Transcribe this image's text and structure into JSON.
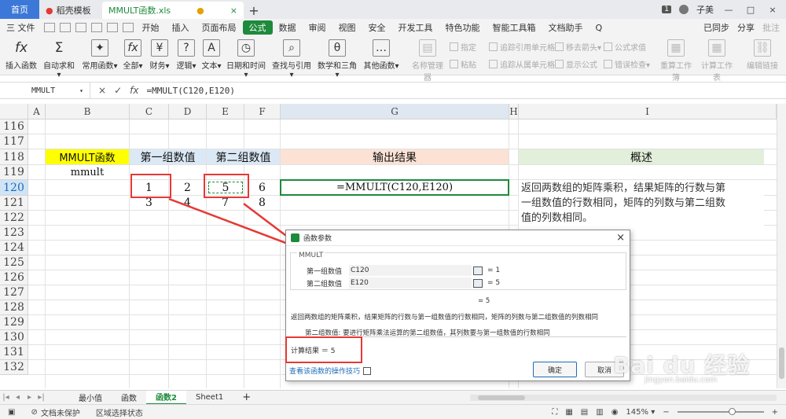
{
  "titlebar": {
    "home": "首页",
    "tab1": "稻壳模板",
    "tab2": "MMULT函数.xls",
    "tab2_dot": "●",
    "tab2_close": "×",
    "plus": "+",
    "badge": "1",
    "user": "子美",
    "min": "—",
    "max": "□",
    "close": "×"
  },
  "menubar": {
    "file": "三 文件",
    "items": [
      "开始",
      "插入",
      "页面布局",
      "公式",
      "数据",
      "审阅",
      "视图",
      "安全",
      "开发工具",
      "特色功能",
      "智能工具箱",
      "文档助手"
    ],
    "search": "Q",
    "sync": "已同步",
    "share": "分享",
    "comment": "批注"
  },
  "ribbon": {
    "buttons": [
      {
        "label": "插入函数",
        "icon": "fx"
      },
      {
        "label": "自动求和▾",
        "icon": "Σ"
      },
      {
        "label": "常用函数▾",
        "icon": "✦"
      },
      {
        "label": "全部▾",
        "icon": "fx"
      },
      {
        "label": "财务▾",
        "icon": "¥"
      },
      {
        "label": "逻辑▾",
        "icon": "?"
      },
      {
        "label": "文本▾",
        "icon": "A"
      },
      {
        "label": "日期和时间▾",
        "icon": "◷"
      },
      {
        "label": "查找与引用▾",
        "icon": "⌕"
      },
      {
        "label": "数学和三角▾",
        "icon": "θ"
      },
      {
        "label": "其他函数▾",
        "icon": "…"
      }
    ],
    "dim_buttons": [
      {
        "label": "名称管理器",
        "icon": "▤"
      },
      {
        "label": "重算工作簿",
        "icon": "▦"
      },
      {
        "label": "计算工作表",
        "icon": "▦"
      },
      {
        "label": "编辑链接",
        "icon": "⛓"
      }
    ],
    "small": [
      "指定",
      "粘贴",
      "追踪引用单元格",
      "追踪从属单元格",
      "移去箭头▾",
      "显示公式",
      "公式求值",
      "错误检查▾"
    ]
  },
  "formula_bar": {
    "name": "MMULT",
    "cancel": "×",
    "confirm": "✓",
    "fx": "fx",
    "formula": "=MMULT(C120,E120)"
  },
  "columns": [
    "A",
    "B",
    "C",
    "D",
    "E",
    "F",
    "G",
    "H",
    "I"
  ],
  "rows": [
    "116",
    "117",
    "118",
    "119",
    "120",
    "121",
    "122",
    "123",
    "124",
    "125",
    "126",
    "127",
    "128",
    "129",
    "130",
    "131",
    "132"
  ],
  "cells": {
    "b118": "MMULT函数",
    "cd118": "第一组数值",
    "ef118": "第二组数值",
    "g118": "输出结果",
    "i118": "概述",
    "b119": "mmult",
    "c120": "1",
    "d120": "2",
    "e120": "5",
    "f120": "6",
    "g120": "=MMULT(C120,E120)",
    "c121": "3",
    "d121": "4",
    "e121": "7",
    "f121": "8",
    "i120_l1": "返回两数组的矩阵乘积，结果矩阵的行数与第",
    "i120_l2": "一组数值的行数相同，矩阵的列数与第二组数",
    "i120_l3": "值的列数相同。"
  },
  "colors": {
    "yellow": "#ffff00",
    "blue_hdr": "#dbe8f5",
    "salmon_hdr": "#fbe2d5",
    "green_hdr": "#e2efda",
    "accent": "#1e8a3c",
    "red": "#e53935"
  },
  "dialog": {
    "title": "函数参数",
    "close": "×",
    "fn": "MMULT",
    "arg1_label": "第一组数值",
    "arg1_value": "C120",
    "arg1_result": "= 1",
    "arg2_label": "第二组数值",
    "arg2_value": "E120",
    "arg2_result": "= 5",
    "overall": "= 5",
    "desc": "返回两数组的矩阵乘积，结果矩阵的行数与第一组数值的行数相同，矩阵的列数与第二组数值的列数相同",
    "arg_desc": "第二组数值:   要进行矩阵乘法运算的第二组数值，其列数要与第一组数值的行数相同",
    "calc": "计算结果 ＝ 5",
    "help": "查看该函数的操作技巧",
    "ok": "确定",
    "cancel": "取消"
  },
  "sheets": [
    "最小值",
    "函数",
    "函数2",
    "Sheet1"
  ],
  "sheet_add": "+",
  "statusbar": {
    "protect": "文档未保护",
    "select_status": "区域选择状态",
    "zoom": "145% ▾",
    "minus": "−",
    "plus": "+"
  },
  "watermark": {
    "brand": "Bai du 经验",
    "url": "jingyan.baidu.com"
  }
}
